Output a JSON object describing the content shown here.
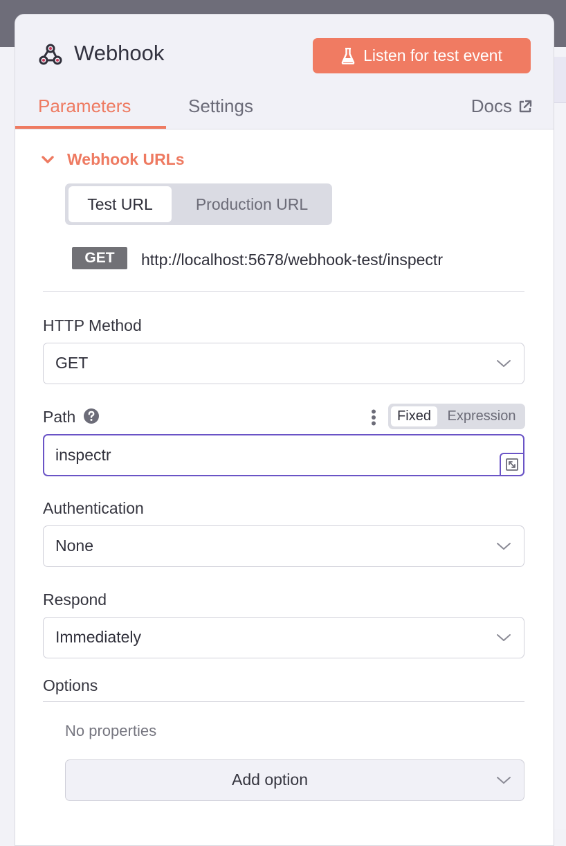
{
  "header": {
    "title": "Webhook",
    "listen_button": "Listen for test event",
    "tabs": [
      {
        "label": "Parameters",
        "active": true
      },
      {
        "label": "Settings",
        "active": false
      }
    ],
    "docs_label": "Docs",
    "accent_color": "#ee7a61"
  },
  "webhook_urls": {
    "section_label": "Webhook URLs",
    "url_tabs": [
      {
        "label": "Test URL",
        "active": true
      },
      {
        "label": "Production URL",
        "active": false
      }
    ],
    "method": "GET",
    "url": "http://localhost:5678/webhook-test/inspectr"
  },
  "fields": {
    "http_method": {
      "label": "HTTP Method",
      "value": "GET"
    },
    "path": {
      "label": "Path",
      "value": "inspectr",
      "mode_options": [
        "Fixed",
        "Expression"
      ],
      "mode_selected": "Fixed"
    },
    "authentication": {
      "label": "Authentication",
      "value": "None"
    },
    "respond": {
      "label": "Respond",
      "value": "Immediately"
    }
  },
  "options": {
    "label": "Options",
    "empty_text": "No properties",
    "add_button": "Add option"
  },
  "icons": [
    "webhook-logo-icon",
    "flask-icon",
    "external-link-icon",
    "chevron-down-icon",
    "help-icon",
    "kebab-menu-icon",
    "expand-icon"
  ]
}
